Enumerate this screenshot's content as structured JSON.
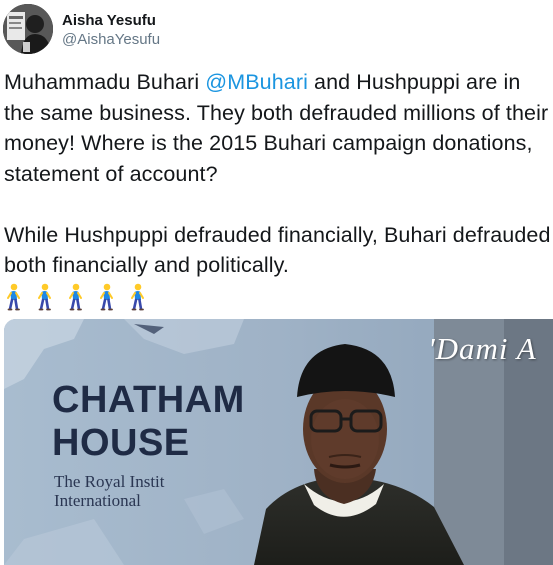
{
  "author": {
    "display_name": "Aisha Yesufu",
    "handle": "@AishaYesufu"
  },
  "tweet": {
    "p1_before_mention": "Muhammadu Buhari ",
    "mention": "@MBuhari",
    "p1_after_mention": " and Hushpuppi are in the same business. They both  defrauded millions of their money! Where is the 2015 Buhari campaign donations, statement of account?",
    "p2": "While Hushpuppi defrauded financially, Buhari defrauded both financially and politically.",
    "emoji_count": 5,
    "emoji_name": "person-walking-icon"
  },
  "media": {
    "sign_line1": "CHATHAM",
    "sign_line2": "HOUSE",
    "sign_sub1": "The Royal Instit",
    "sign_sub2": "International",
    "watermark": "'Dami A"
  },
  "colors": {
    "link": "#1b95e0",
    "handle": "#657786",
    "text": "#14171a"
  }
}
